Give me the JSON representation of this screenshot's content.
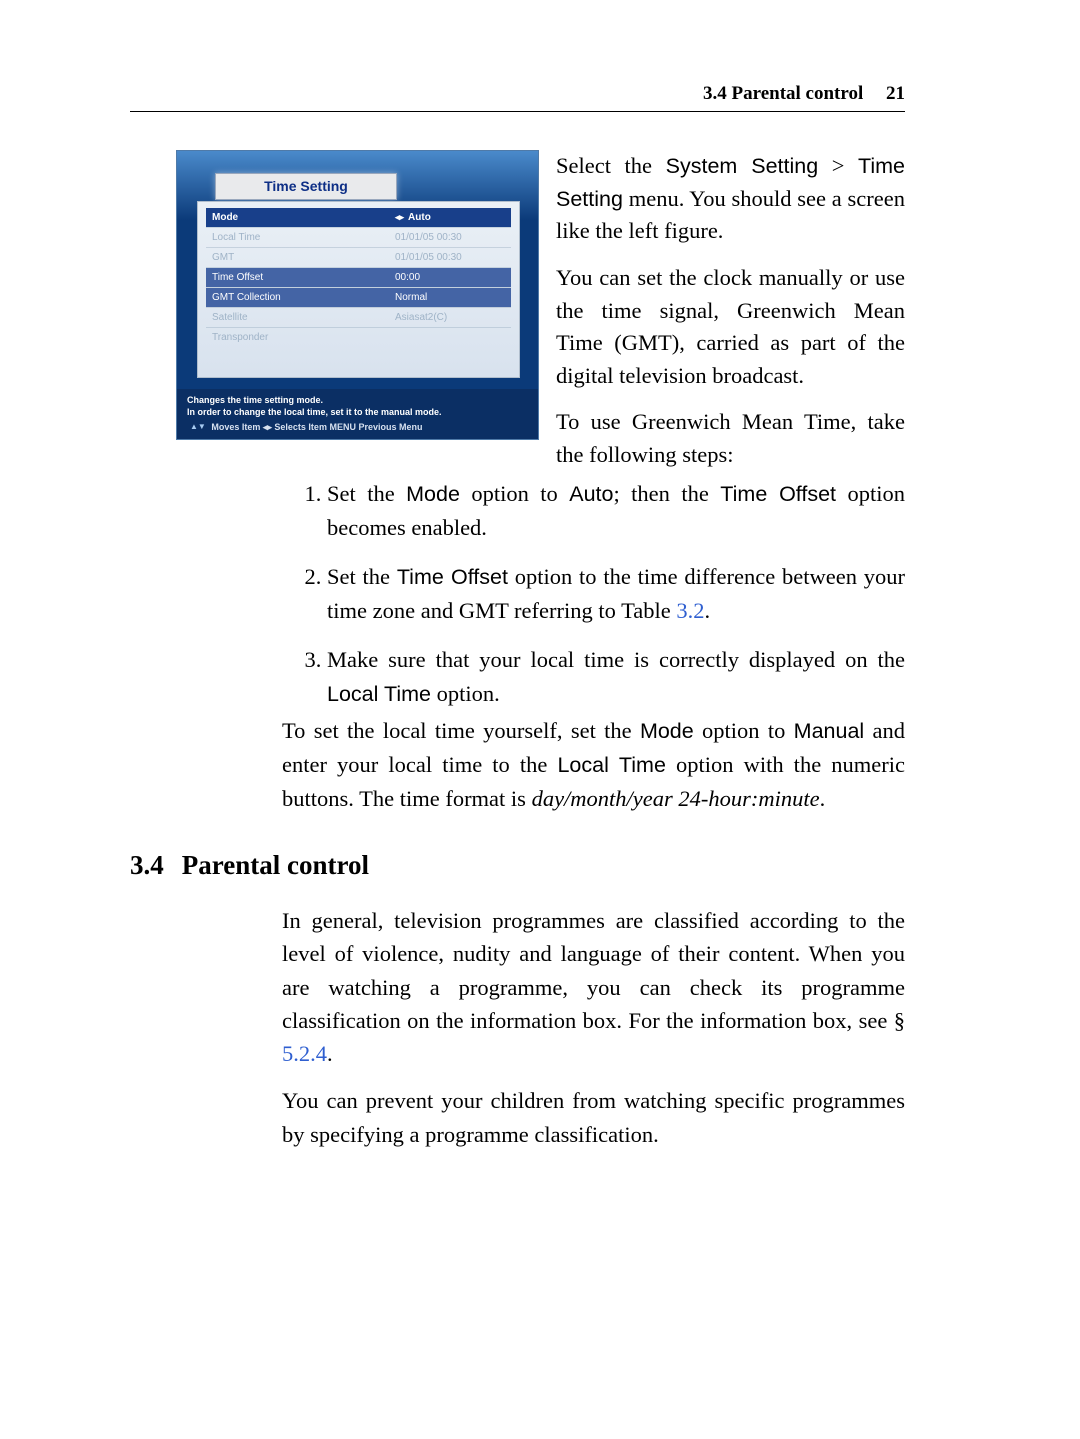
{
  "header": {
    "section": "3.4 Parental control",
    "page": "21"
  },
  "figure": {
    "tab": "Time Setting",
    "rows": [
      {
        "label": "Mode",
        "value": "Auto",
        "arrows": "◂▸",
        "cls": "hilite"
      },
      {
        "label": "Local Time",
        "value": "01/01/05 00:30"
      },
      {
        "label": "GMT",
        "value": "01/01/05 00:30"
      },
      {
        "label": "Time Offset",
        "value": "00:00",
        "cls": "active"
      },
      {
        "label": "GMT Collection",
        "value": "Normal",
        "cls": "active"
      },
      {
        "label": "Satellite",
        "value": "Asiasat2(C)"
      },
      {
        "label": "Transponder",
        "value": ""
      }
    ],
    "hint1": "Changes the time setting mode.",
    "hint2": "In order to change the local time, set it to the manual mode.",
    "keys": "Moves Item ◂▸ Selects Item MENU Previous Menu"
  },
  "side": {
    "p1a": "Select the ",
    "p1opt1": "System Setting",
    "p1gt": " > ",
    "p1opt2": "Time Setting",
    "p1b": " menu. You should see a screen like the left figure.",
    "p2": "You can set the clock manually or use the time signal, Greenwich Mean Time (GMT), carried as part of the digital television broadcast.",
    "p3": "To use Greenwich Mean Time, take the following steps:"
  },
  "steps": {
    "s1a": "Set the ",
    "s1m": "Mode",
    "s1b": " option to ",
    "s1auto": "Auto",
    "s1c": "; then the ",
    "s1to": "Time Offset",
    "s1d": " option becomes enabled.",
    "s2a": "Set the ",
    "s2to": "Time Offset",
    "s2b": " option to the time difference between your time zone and GMT referring to Table ",
    "s2ref": "3.2",
    "s2c": ".",
    "s3a": "Make sure that your local time is correctly displayed on the ",
    "s3lt": "Local Time",
    "s3b": " option."
  },
  "lower": {
    "a": "To set the local time yourself, set the ",
    "mode": "Mode",
    "b": " option to ",
    "man": "Manual",
    "c": " and enter your local time to the ",
    "lt": "Local Time",
    "d": " option with the numeric buttons. The time format is ",
    "fmt": "day/month/year 24-hour:minute",
    "e": "."
  },
  "section": {
    "num": "3.4",
    "title": "Parental control",
    "p1a": "In general, television programmes are classified according to the level of violence, nudity and language of their content. When you are watching a programme, you can check its programme classification on the information box. For the information box, see § ",
    "p1ref": "5.2.4",
    "p1b": ".",
    "p2": "You can prevent your children from watching specific programmes by specifying a programme classification."
  }
}
